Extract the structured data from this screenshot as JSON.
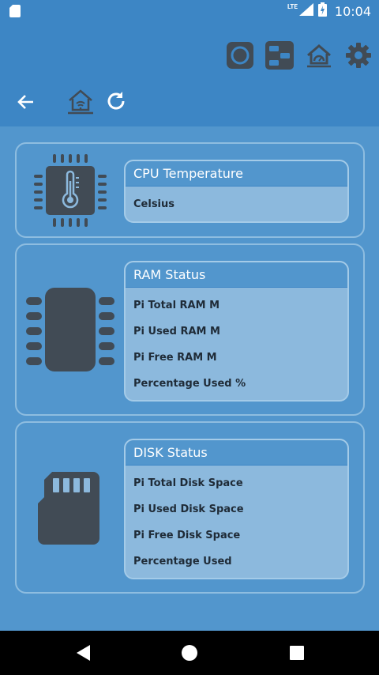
{
  "status_bar": {
    "time": "10:04",
    "network": "LTE"
  },
  "app_bar": {
    "icons": [
      "circle-icon",
      "toggles-icon",
      "home-dashboard-icon",
      "settings-icon"
    ],
    "nav": [
      "back-arrow-icon",
      "home-wifi-icon",
      "refresh-icon"
    ]
  },
  "cpu": {
    "title": "CPU Temperature",
    "lines": [
      "Celsius"
    ]
  },
  "ram": {
    "title": "RAM Status",
    "lines": [
      "Pi Total RAM   M",
      "Pi Used RAM  M",
      "Pi Free RAM   M",
      "Percentage Used %"
    ]
  },
  "disk": {
    "title": "DISK Status",
    "lines": [
      "Pi Total Disk Space",
      "Pi Used Disk Space",
      "Pi Free Disk Space",
      "Percentage Used"
    ]
  },
  "colors": {
    "background": "#5296CD",
    "app_bar": "#3D86C5",
    "card": "#8CB9DD",
    "icon_dark": "#414B55"
  },
  "bottom_nav": [
    "back-triangle-icon",
    "home-circle-icon",
    "recents-square-icon"
  ]
}
